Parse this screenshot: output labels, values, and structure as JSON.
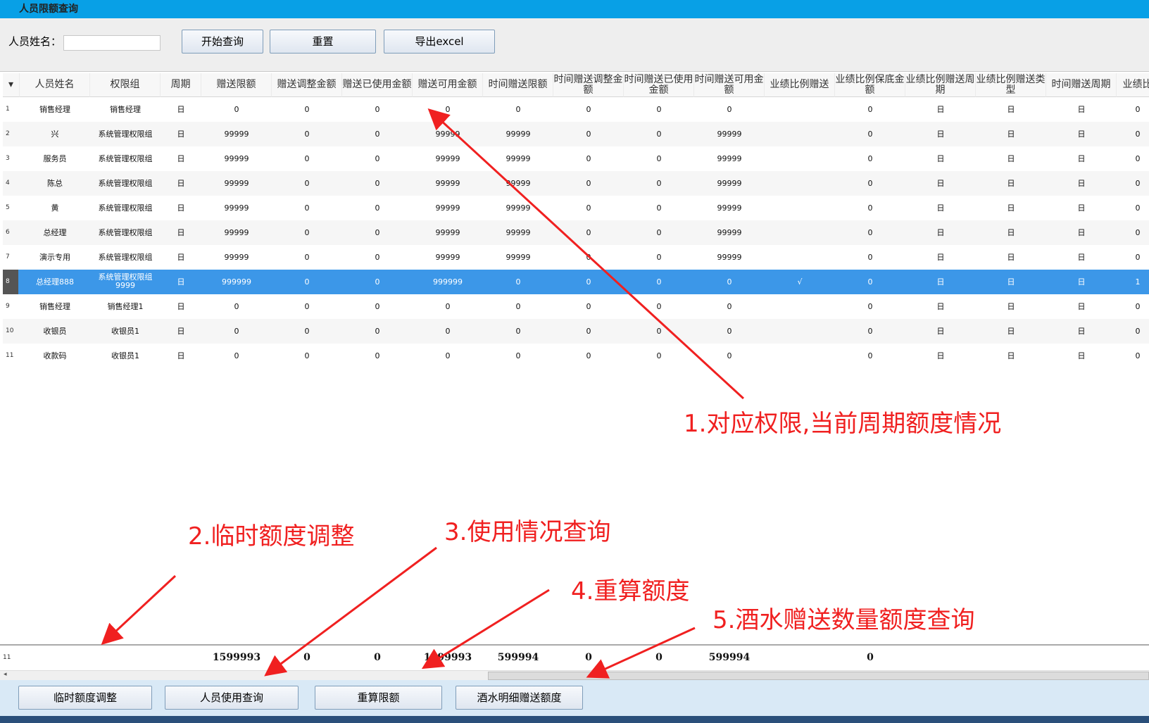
{
  "window": {
    "title": "人员限额查询"
  },
  "search": {
    "label": "人员姓名：",
    "value": "",
    "buttons": [
      "开始查询",
      "重置",
      "导出excel"
    ]
  },
  "grid": {
    "columns": [
      "人员姓名",
      "权限组",
      "周期",
      "赠送限额",
      "赠送调整金额",
      "赠送已使用金额",
      "赠送可用金额",
      "时间赠送限额",
      "时间赠送调整金额",
      "时间赠送已使用金额",
      "时间赠送可用金额",
      "业绩比例赠送",
      "业绩比例保底金额",
      "业绩比例赠送周期",
      "业绩比例赠送类型",
      "时间赠送周期",
      "业绩比"
    ],
    "rows": [
      [
        "1",
        "销售经理",
        "销售经理",
        "日",
        "0",
        "0",
        "0",
        "0",
        "0",
        "0",
        "0",
        "0",
        "",
        "0",
        "日",
        "日",
        "日",
        "0"
      ],
      [
        "2",
        "兴",
        "系统管理权限组",
        "日",
        "99999",
        "0",
        "0",
        "99999",
        "99999",
        "0",
        "0",
        "99999",
        "",
        "0",
        "日",
        "日",
        "日",
        "0"
      ],
      [
        "3",
        "服务员",
        "系统管理权限组",
        "日",
        "99999",
        "0",
        "0",
        "99999",
        "99999",
        "0",
        "0",
        "99999",
        "",
        "0",
        "日",
        "日",
        "日",
        "0"
      ],
      [
        "4",
        "陈总",
        "系统管理权限组",
        "日",
        "99999",
        "0",
        "0",
        "99999",
        "99999",
        "0",
        "0",
        "99999",
        "",
        "0",
        "日",
        "日",
        "日",
        "0"
      ],
      [
        "5",
        "黄",
        "系统管理权限组",
        "日",
        "99999",
        "0",
        "0",
        "99999",
        "99999",
        "0",
        "0",
        "99999",
        "",
        "0",
        "日",
        "日",
        "日",
        "0"
      ],
      [
        "6",
        "总经理",
        "系统管理权限组",
        "日",
        "99999",
        "0",
        "0",
        "99999",
        "99999",
        "0",
        "0",
        "99999",
        "",
        "0",
        "日",
        "日",
        "日",
        "0"
      ],
      [
        "7",
        "演示专用",
        "系统管理权限组",
        "日",
        "99999",
        "0",
        "0",
        "99999",
        "99999",
        "0",
        "0",
        "99999",
        "",
        "0",
        "日",
        "日",
        "日",
        "0"
      ],
      [
        "8",
        "总经理888",
        "系统管理权限组9999",
        "日",
        "999999",
        "0",
        "0",
        "999999",
        "0",
        "0",
        "0",
        "0",
        "√",
        "0",
        "日",
        "日",
        "日",
        "1"
      ],
      [
        "9",
        "销售经理",
        "销售经理1",
        "日",
        "0",
        "0",
        "0",
        "0",
        "0",
        "0",
        "0",
        "0",
        "",
        "0",
        "日",
        "日",
        "日",
        "0"
      ],
      [
        "10",
        "收银员",
        "收银员1",
        "日",
        "0",
        "0",
        "0",
        "0",
        "0",
        "0",
        "0",
        "0",
        "",
        "0",
        "日",
        "日",
        "日",
        "0"
      ],
      [
        "11",
        "收款码",
        "收银员1",
        "日",
        "0",
        "0",
        "0",
        "0",
        "0",
        "0",
        "0",
        "0",
        "",
        "0",
        "日",
        "日",
        "日",
        "0"
      ]
    ],
    "selected_row": 8
  },
  "footer": {
    "count": "11",
    "totals": [
      "1599993",
      "0",
      "0",
      "1599993",
      "599994",
      "0",
      "0",
      "599994",
      "",
      "0"
    ]
  },
  "actions": [
    "临时额度调整",
    "人员使用查询",
    "重算限额",
    "酒水明细赠送额度"
  ],
  "annotations": [
    "1.对应权限,当前周期额度情况",
    "2.临时额度调整",
    "3.使用情况查询",
    "4.重算额度",
    "5.酒水赠送数量额度查询"
  ],
  "colors": {
    "titlebar": "#08a0e6",
    "selection": "#3c97e8",
    "annotation": "#f02020"
  }
}
